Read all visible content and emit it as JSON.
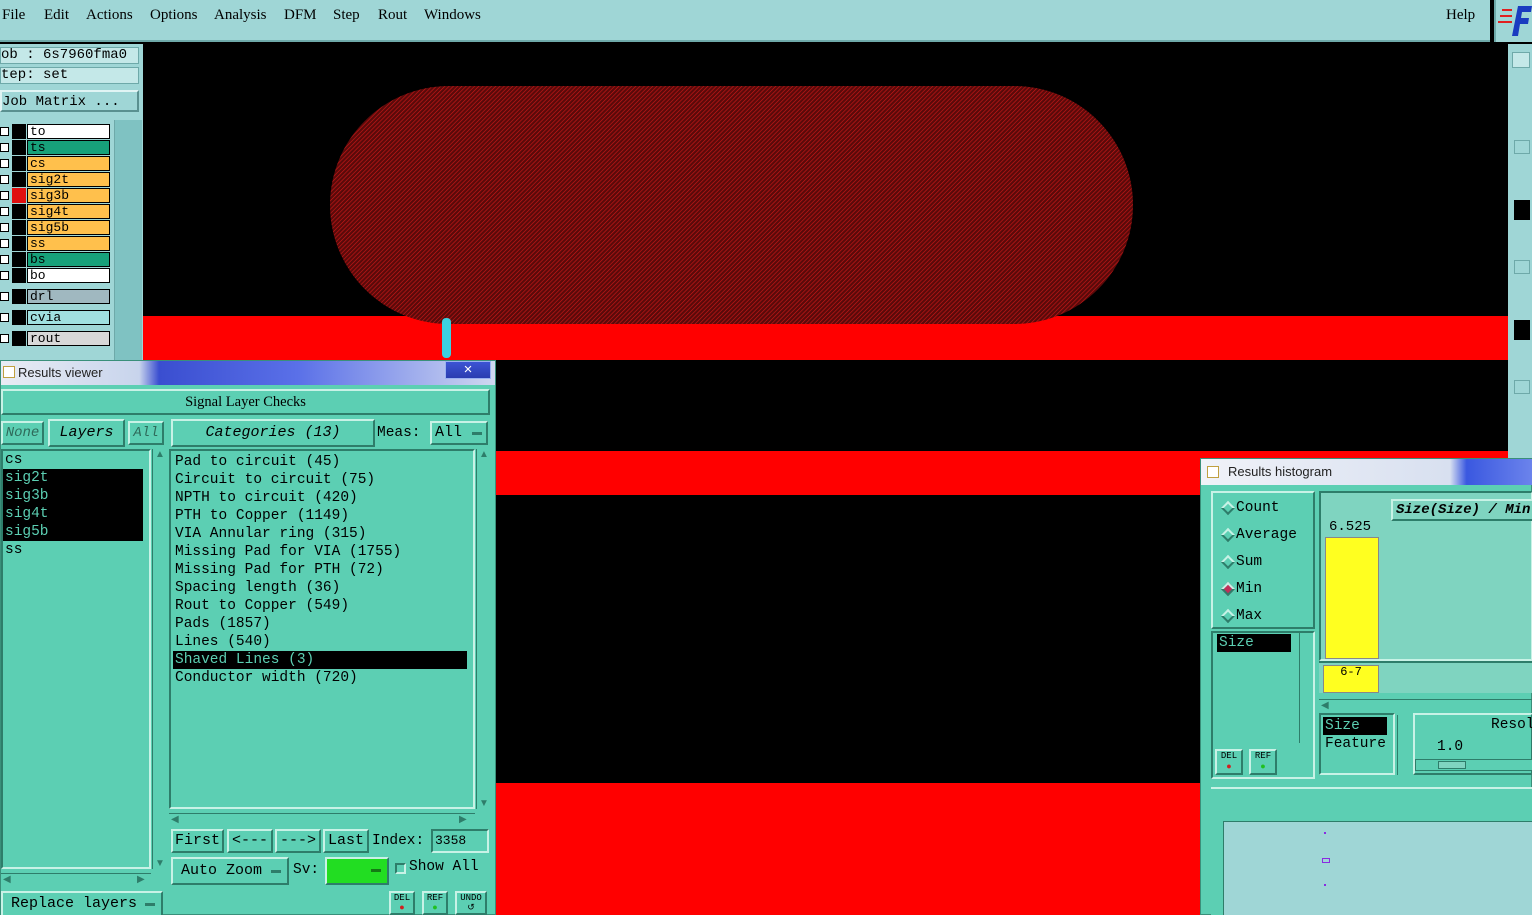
{
  "menu": {
    "file": "File",
    "edit": "Edit",
    "actions": "Actions",
    "options": "Options",
    "analysis": "Analysis",
    "dfm": "DFM",
    "step": "Step",
    "rout": "Rout",
    "windows": "Windows",
    "help": "Help"
  },
  "job": {
    "job_label": "ob : 6s7960fma0",
    "step_label": "tep: set",
    "matrix_button": "Job Matrix ..."
  },
  "layers": [
    {
      "name": "to",
      "color": "#ffffff"
    },
    {
      "name": "ts",
      "color": "#17a17a"
    },
    {
      "name": "cs",
      "color": "#ffc04c"
    },
    {
      "name": "sig2t",
      "color": "#ffc04c"
    },
    {
      "name": "sig3b",
      "color": "#ffc04c"
    },
    {
      "name": "sig4t",
      "color": "#ffc04c"
    },
    {
      "name": "sig5b",
      "color": "#ffc04c"
    },
    {
      "name": "ss",
      "color": "#ffc04c"
    },
    {
      "name": "bs",
      "color": "#17a17a"
    },
    {
      "name": "bo",
      "color": "#ffffff"
    },
    {
      "name": "drl",
      "color": "#a0b8c0"
    },
    {
      "name": "cvia",
      "color": "#a0e0e0"
    },
    {
      "name": "rout",
      "color": "#d8d8d8"
    }
  ],
  "results_viewer": {
    "title": "Results viewer",
    "close": "×",
    "heading": "Signal Layer Checks",
    "none_btn": "None",
    "layers_btn": "Layers",
    "all_btn": "All",
    "categories_btn": "Categories (13)",
    "meas_label": "Meas:",
    "meas_value": "All",
    "layer_list": [
      "cs",
      "sig2t",
      "sig3b",
      "sig4t",
      "sig5b",
      "ss"
    ],
    "categories": [
      "Pad to circuit (45)",
      "Circuit to circuit (75)",
      "NPTH to circuit (420)",
      "PTH to Copper (1149)",
      "VIA Annular ring (315)",
      "Missing Pad for VIA (1755)",
      "Missing Pad for PTH (72)",
      "Spacing length (36)",
      "Rout to Copper (549)",
      "Pads (1857)",
      "Lines (540)",
      "Shaved Lines (3)",
      "Conductor width (720)"
    ],
    "first_btn": "First",
    "prev_btn": "<---",
    "next_btn": "--->",
    "last_btn": "Last",
    "index_label": "Index:",
    "index_value": "3358",
    "autozoom_btn": "Auto Zoom",
    "sv_label": "Sv:",
    "show_all_label": "Show All",
    "replace_layers_btn": "Replace layers",
    "del_btn": "DEL",
    "ref_btn": "REF",
    "undo_btn": "UNDO"
  },
  "histogram": {
    "title": "Results histogram",
    "options": [
      "Count",
      "Average",
      "Sum",
      "Min",
      "Max"
    ],
    "selected": "Min",
    "field_list": [
      "Size"
    ],
    "graph_title": "Size(Size) / Min",
    "bar_value": "6.525",
    "bar_label": "6-7",
    "attr_list": [
      "Size",
      "Feature"
    ],
    "resolution_label": "Resol",
    "resolution_value": "1.0",
    "del_btn": "DEL",
    "ref_btn": "REF"
  }
}
